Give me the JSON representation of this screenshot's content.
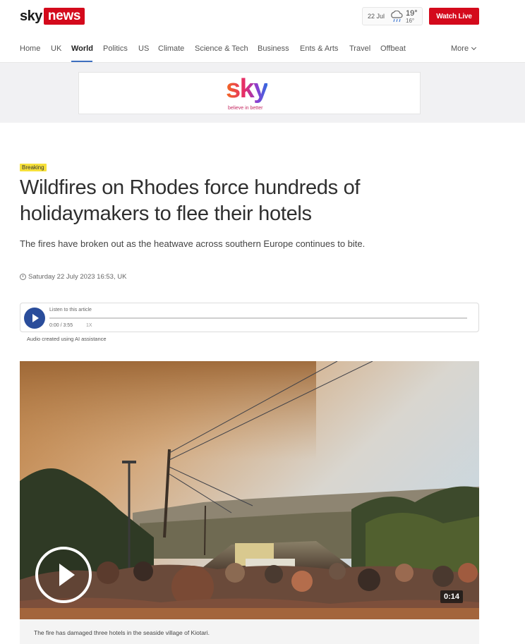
{
  "header": {
    "logo_sky": "sky",
    "logo_news": "news",
    "weather": {
      "date": "22 Jul",
      "high": "19°",
      "low": "16°",
      "icon": "rain-cloud-icon"
    },
    "watch_live_label": "Watch Live"
  },
  "nav": {
    "items": [
      {
        "label": "Home"
      },
      {
        "label": "UK"
      },
      {
        "label": "World",
        "active": true
      },
      {
        "label": "Politics"
      },
      {
        "label": "US"
      },
      {
        "label": "Climate"
      },
      {
        "label": "Science & Tech"
      },
      {
        "label": "Business"
      },
      {
        "label": "Ents & Arts"
      },
      {
        "label": "Travel"
      },
      {
        "label": "Offbeat"
      }
    ],
    "more_label": "More"
  },
  "ad": {
    "brand": "sky",
    "tagline": "believe in better"
  },
  "article": {
    "badge": "Breaking",
    "headline": "Wildfires on Rhodes force hundreds of holidaymakers to flee their hotels",
    "standfirst": "The fires have broken out as the heatwave across southern Europe continues to bite.",
    "timestamp": "Saturday 22 July 2023 16:53, UK"
  },
  "audio": {
    "label": "Listen to this article",
    "time": "0:00 / 3:55",
    "speed": "1X",
    "note": "Audio created using AI assistance"
  },
  "video": {
    "duration": "0:14",
    "caption": "The fire has damaged three hotels in the seaside village of Kiotari."
  },
  "colors": {
    "brand_red": "#d40a1c",
    "play_blue": "#2a4d9b",
    "breaking_yellow": "#f6e03a",
    "nav_active": "#3d6fbf"
  }
}
